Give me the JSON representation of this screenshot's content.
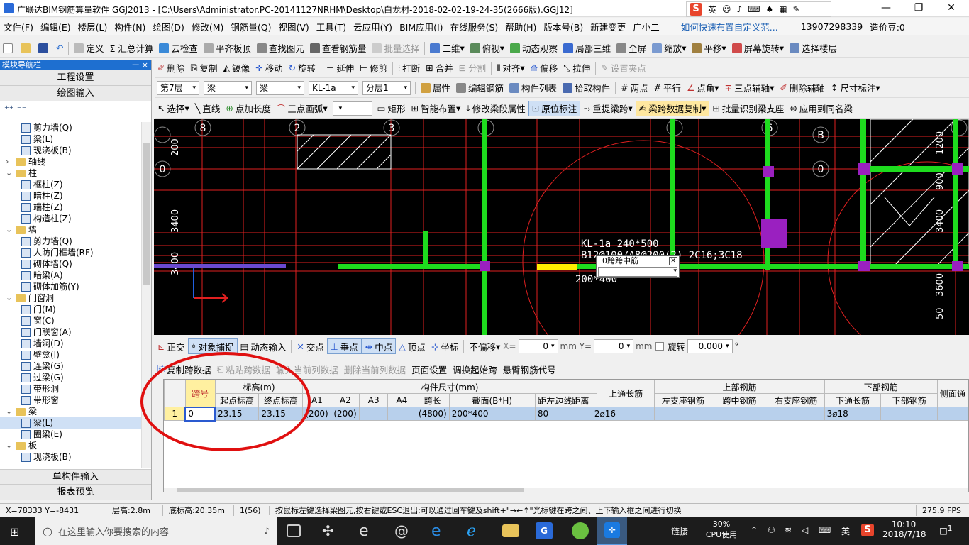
{
  "titlebar": {
    "title": "广联达BIM钢筋算量软件 GGJ2013 - [C:\\Users\\Administrator.PC-20141127NRHM\\Desktop\\白龙村-2018-02-02-19-24-35(2666版).GGJ12]",
    "ime": "英"
  },
  "menu": [
    "文件(F)",
    "编辑(E)",
    "楼层(L)",
    "构件(N)",
    "绘图(D)",
    "修改(M)",
    "钢筋量(Q)",
    "视图(V)",
    "工具(T)",
    "云应用(Y)",
    "BIM应用(I)",
    "在线服务(S)",
    "帮助(H)",
    "版本号(B)",
    "新建变更",
    "广小二",
    "如何快速布置自定义范...",
    "13907298339",
    "造价豆:0"
  ],
  "toolbar1": [
    "定义",
    "Σ 汇总计算",
    "云检查",
    "平齐板顶",
    "查找图元",
    "查看钢筋量",
    "批量选择",
    "二维",
    "俯视",
    "动态观察",
    "局部三维",
    "全屏",
    "缩放",
    "平移",
    "屏幕旋转",
    "选择楼层"
  ],
  "toolbar2": [
    "删除",
    "复制",
    "镜像",
    "移动",
    "旋转",
    "延伸",
    "修剪",
    "打断",
    "合并",
    "分割",
    "对齐",
    "偏移",
    "拉伸",
    "设置夹点"
  ],
  "toolbar3": {
    "floor": "第7层",
    "type1": "梁",
    "type2": "梁",
    "name": "KL-1a",
    "layer": "分层1",
    "items": [
      "属性",
      "编辑钢筋",
      "构件列表",
      "拾取构件",
      "两点",
      "平行",
      "点角",
      "三点辅轴",
      "删除辅轴",
      "尺寸标注"
    ]
  },
  "toolbar4": [
    "选择",
    "直线",
    "点加长度",
    "三点画弧",
    "矩形",
    "智能布置",
    "修改梁段属性",
    "原位标注",
    "重提梁跨",
    "梁跨数据复制",
    "批量识别梁支座",
    "应用到同名梁"
  ],
  "panel": {
    "header": "模块导航栏",
    "pin": "ᅳ ×",
    "btn1": "工程设置",
    "btn2": "绘图输入",
    "btn3": "单构件输入",
    "btn4": "报表预览"
  },
  "tree": [
    {
      "indent": 2,
      "type": "leaf",
      "label": "剪力墙(Q)"
    },
    {
      "indent": 2,
      "type": "leaf",
      "label": "梁(L)"
    },
    {
      "indent": 2,
      "type": "leaf",
      "label": "现浇板(B)"
    },
    {
      "indent": 0,
      "type": "folder",
      "label": "轴线",
      "exp": "+"
    },
    {
      "indent": 0,
      "type": "folder",
      "label": "柱",
      "exp": "-"
    },
    {
      "indent": 2,
      "type": "leaf",
      "label": "框柱(Z)"
    },
    {
      "indent": 2,
      "type": "leaf",
      "label": "暗柱(Z)"
    },
    {
      "indent": 2,
      "type": "leaf",
      "label": "端柱(Z)"
    },
    {
      "indent": 2,
      "type": "leaf",
      "label": "构造柱(Z)"
    },
    {
      "indent": 0,
      "type": "folder",
      "label": "墙",
      "exp": "-"
    },
    {
      "indent": 2,
      "type": "leaf",
      "label": "剪力墙(Q)"
    },
    {
      "indent": 2,
      "type": "leaf",
      "label": "人防门框墙(RF)"
    },
    {
      "indent": 2,
      "type": "leaf",
      "label": "砌体墙(Q)"
    },
    {
      "indent": 2,
      "type": "leaf",
      "label": "暗梁(A)"
    },
    {
      "indent": 2,
      "type": "leaf",
      "label": "砌体加筋(Y)"
    },
    {
      "indent": 0,
      "type": "folder",
      "label": "门窗洞",
      "exp": "-"
    },
    {
      "indent": 2,
      "type": "leaf",
      "label": "门(M)"
    },
    {
      "indent": 2,
      "type": "leaf",
      "label": "窗(C)"
    },
    {
      "indent": 2,
      "type": "leaf",
      "label": "门联窗(A)"
    },
    {
      "indent": 2,
      "type": "leaf",
      "label": "墙洞(D)"
    },
    {
      "indent": 2,
      "type": "leaf",
      "label": "壁龛(I)"
    },
    {
      "indent": 2,
      "type": "leaf",
      "label": "连梁(G)"
    },
    {
      "indent": 2,
      "type": "leaf",
      "label": "过梁(G)"
    },
    {
      "indent": 2,
      "type": "leaf",
      "label": "带形洞"
    },
    {
      "indent": 2,
      "type": "leaf",
      "label": "带形窗"
    },
    {
      "indent": 0,
      "type": "folder",
      "label": "梁",
      "exp": "-"
    },
    {
      "indent": 2,
      "type": "leaf",
      "label": "梁(L)"
    },
    {
      "indent": 2,
      "type": "leaf",
      "label": "圈梁(E)"
    },
    {
      "indent": 0,
      "type": "folder",
      "label": "板",
      "exp": "-"
    },
    {
      "indent": 2,
      "type": "leaf",
      "label": "现浇板(B)"
    }
  ],
  "canvas": {
    "axis_labels": [
      "8",
      "2",
      "3",
      "6",
      "B",
      "0",
      "0"
    ],
    "dim_labels": [
      "200",
      "3400",
      "3400",
      "900",
      "1200",
      "3400",
      "50",
      "3600"
    ],
    "beam_text1": "KL-1a 240*500",
    "beam_text2": "B12@100/A8@200(2)  2C16;3C18",
    "beam_text3": "200*400",
    "popup_title": "0跨跨中筋"
  },
  "snapbar": [
    "正交",
    "对象捕捉",
    "动态输入",
    "交点",
    "垂点",
    "中点",
    "顶点",
    "坐标",
    "不偏移",
    "X=",
    "0",
    "mm Y=",
    "0",
    "mm",
    "旋转",
    "0.000",
    "°"
  ],
  "tablebar": [
    "复制跨数据",
    "粘贴跨数据",
    "输入当前列数据",
    "删除当前列数据",
    "页面设置",
    "调换起始跨",
    "悬臂钢筋代号"
  ],
  "table": {
    "h_group1": "标高(m)",
    "h_group2": "构件尺寸(mm)",
    "h_group3": "上部钢筋",
    "h_group4": "下部钢筋",
    "headers": [
      "跨号",
      "起点标高",
      "终点标高",
      "A1",
      "A2",
      "A3",
      "A4",
      "跨长",
      "截面(B*H)",
      "距左边线距离",
      "上通长筋",
      "左支座钢筋",
      "跨中钢筋",
      "右支座钢筋",
      "下通长筋",
      "下部钢筋",
      "侧面通"
    ],
    "row": [
      "1",
      "0",
      "23.15",
      "23.15",
      "(200)",
      "(200)",
      "",
      "",
      "(4800)",
      "200*400",
      "80",
      "2⌀16",
      "",
      "",
      "",
      "3⌀18",
      "",
      ""
    ]
  },
  "statusbar": [
    "X=78333 Y=-8431",
    "层高:2.8m",
    "底标高:20.35m",
    "1(56)",
    "按鼠标左键选择梁图元,按右键或ESC退出;可以通过回车键及shift+\"→←↑\"光标键在跨之间、上下输入框之间进行切换",
    "275.9 FPS"
  ],
  "taskbar": {
    "search": "在这里输入你要搜索的内容",
    "link": "链接",
    "cpu": "30%",
    "cpu_label": "CPU使用",
    "lang": "英",
    "time": "10:10",
    "date": "2018/7/18",
    "notif": "1"
  }
}
